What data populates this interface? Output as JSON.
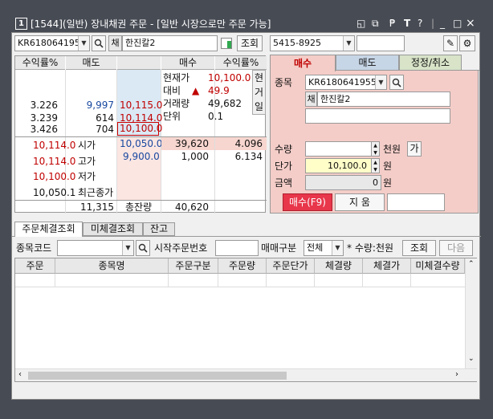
{
  "window": {
    "number": "1",
    "title": "[1544](일반) 장내채권 주문 - [일반 시장으로만 주문 가능]",
    "icons": [
      "◱",
      "⧉",
      "₱",
      "T",
      "?",
      "_",
      "□",
      "×"
    ]
  },
  "left": {
    "code": "KR6180641955",
    "chae_label": "채",
    "name": "한진칼2",
    "query_btn": "조회",
    "headers": {
      "sell_yield": "수익률%",
      "sell": "매도",
      "buy": "매수",
      "buy_yield": "수익률%"
    },
    "info": {
      "cur_label": "현재가",
      "cur_val": "10,100.0",
      "diff_label": "대비",
      "diff_arrow": "▲",
      "diff_val": "49.9",
      "vol_label": "거래량",
      "vol_val": "49,682",
      "unit_label": "단위",
      "unit_val": "0.1"
    },
    "side_tabs": [
      "현",
      "거",
      "일"
    ],
    "ask_rows": [
      {
        "yield": "3.226",
        "qty": "9,997",
        "price": "10,115.0"
      },
      {
        "yield": "3.239",
        "qty": "614",
        "price": "10,114.0"
      },
      {
        "yield": "3.426",
        "qty": "704",
        "price": "10,100.0"
      }
    ],
    "summary": [
      {
        "price": "10,114.0",
        "label": "시가"
      },
      {
        "price": "10,114.0",
        "label": "고가"
      },
      {
        "price": "10,100.0",
        "label": "저가"
      },
      {
        "price": "10,050.1",
        "label": "최근종가"
      }
    ],
    "bid_rows": [
      {
        "price": "10,050.0",
        "qty": "39,620",
        "yield": "4.096"
      },
      {
        "price": "9,900.0",
        "qty": "1,000",
        "yield": "6.134"
      }
    ],
    "total_sell": "11,315",
    "total_label": "총잔량",
    "total_buy": "40,620"
  },
  "right": {
    "account": "5415-8925",
    "tabs": [
      "매수",
      "매도",
      "정정/취소"
    ],
    "code_label": "종목",
    "code": "KR6180641955",
    "chae_label": "채",
    "name": "한진칼2",
    "qty_label": "수량",
    "qty_unit": "천원",
    "ga_btn": "가",
    "price_label": "단가",
    "price": "10,100.0",
    "price_unit": "원",
    "amount_label": "금액",
    "amount": "0",
    "amount_unit": "원",
    "buy_btn": "매수(F9)",
    "clear_btn": "지 움"
  },
  "bottom": {
    "tabs": [
      "주문체결조회",
      "미체결조회",
      "잔고"
    ],
    "code_label": "종목코드",
    "start_label": "시작주문번호",
    "trade_label": "매매구분",
    "trade_val": "전체",
    "note": "* 수량:천원",
    "query_btn": "조회",
    "next_btn": "다음",
    "columns": [
      "주문",
      "종목명",
      "주문구분",
      "주문량",
      "주문단가",
      "체결량",
      "체결가",
      "미체결수량"
    ]
  },
  "colors": {
    "titlebar": "#474b54",
    "buy_tab": "#f3c9c6",
    "buy_red": "#e8364a",
    "price_yellow": "#fffec9"
  }
}
